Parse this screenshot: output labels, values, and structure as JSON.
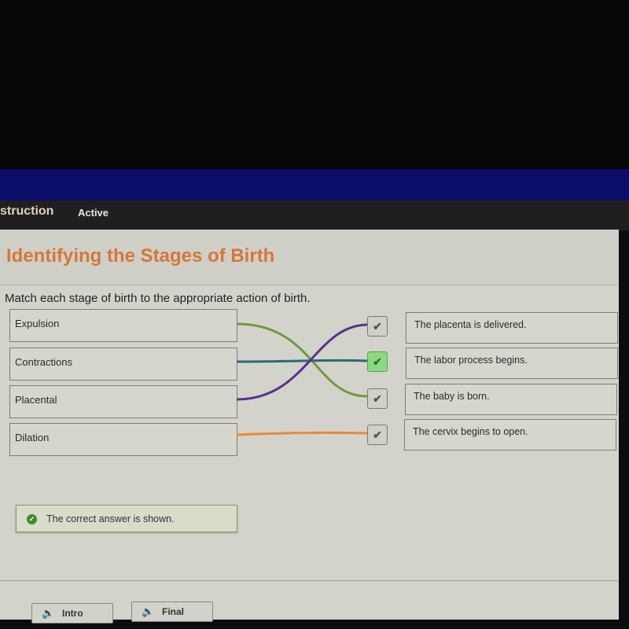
{
  "header": {
    "nav_items": [
      {
        "label": "struction"
      },
      {
        "label": "Active"
      }
    ]
  },
  "activity": {
    "title": "Identifying the Stages of Birth",
    "instruction": "Match each stage of birth to the appropriate action of birth.",
    "stages": [
      "Expulsion",
      "Contractions",
      "Placental",
      "Dilation"
    ],
    "actions": [
      "The placenta is delivered.",
      "The labor process begins.",
      "The baby is born.",
      "The cervix begins to open."
    ],
    "matches": [
      {
        "stage": "Expulsion",
        "action": "The baby is born.",
        "color": "#6e9a3c"
      },
      {
        "stage": "Contractions",
        "action": "The labor process begins.",
        "color": "#2a6a7a"
      },
      {
        "stage": "Placental",
        "action": "The placenta is delivered.",
        "color": "#5a2f8c"
      },
      {
        "stage": "Dilation",
        "action": "The cervix begins to open.",
        "color": "#e8893c"
      }
    ],
    "checks": [
      {
        "icon": "checkmark-icon",
        "highlighted": false
      },
      {
        "icon": "checkmark-icon",
        "highlighted": true
      },
      {
        "icon": "checkmark-icon",
        "highlighted": false
      },
      {
        "icon": "checkmark-icon",
        "highlighted": false
      }
    ],
    "feedback": "The correct answer is shown."
  },
  "footer": {
    "intro_label": "Intro",
    "final_label": "Final",
    "icon": "speaker-icon"
  },
  "colors": {
    "title": "#d4773a",
    "header_blue": "#0c0c6a",
    "nav_bg": "#201e1e",
    "correct_green": "#8fd882"
  }
}
